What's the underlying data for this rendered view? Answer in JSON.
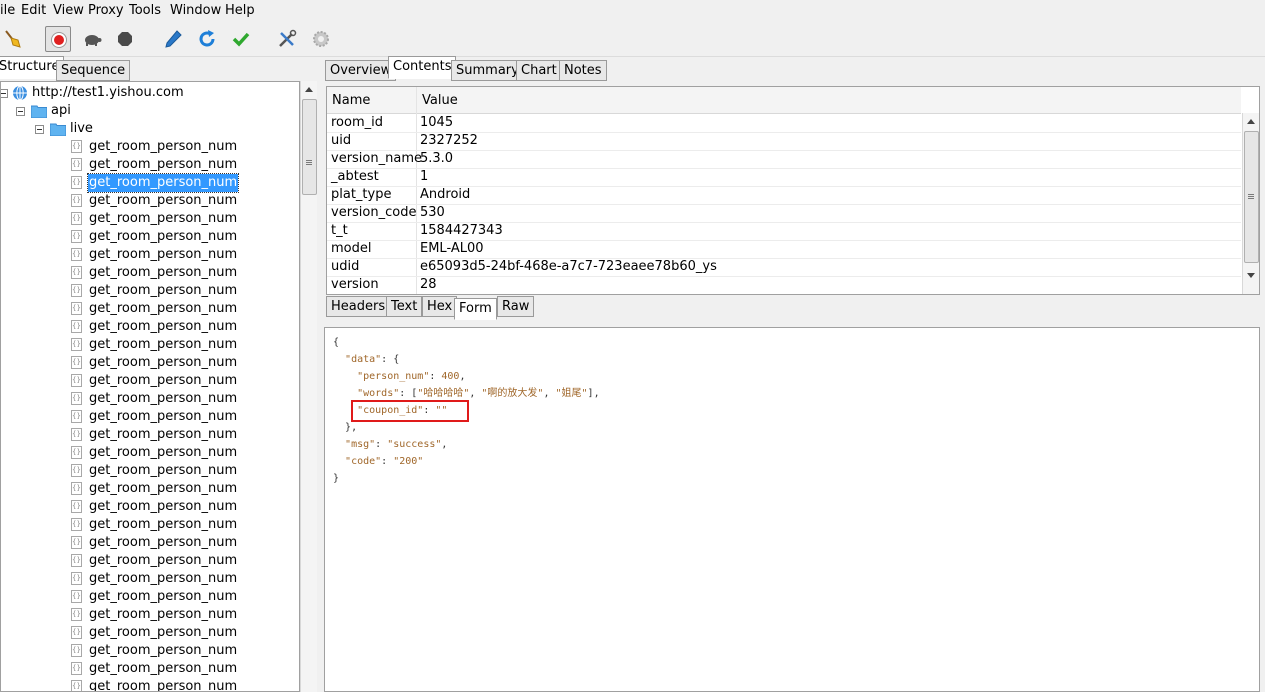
{
  "menubar": {
    "items": [
      "ile",
      "Edit",
      "View",
      "Proxy",
      "Tools",
      "Window",
      "Help"
    ]
  },
  "toolbar": {
    "buttons": [
      {
        "icon": "broom-icon"
      },
      {
        "icon": "record-icon",
        "pressed": true
      },
      {
        "icon": "turtle-icon"
      },
      {
        "icon": "stop-hexagon-icon"
      },
      {
        "icon": "pen-icon"
      },
      {
        "icon": "refresh-icon"
      },
      {
        "icon": "checkmark-icon"
      },
      {
        "icon": "tools-icon"
      },
      {
        "icon": "settings-gear-icon"
      }
    ],
    "colors": {
      "record": "#e02020",
      "refresh": "#1e7fd8",
      "check": "#2fa82f"
    }
  },
  "left_panel": {
    "tabs": [
      "Structure",
      "Sequence"
    ],
    "active_tab": "Structure",
    "tree": {
      "host": "http://test1.yishou.com",
      "folders": [
        "api",
        "live"
      ],
      "requests": [
        "get_room_person_num",
        "get_room_person_num",
        "get_room_person_num",
        "get_room_person_num",
        "get_room_person_num",
        "get_room_person_num",
        "get_room_person_num",
        "get_room_person_num",
        "get_room_person_num",
        "get_room_person_num",
        "get_room_person_num",
        "get_room_person_num",
        "get_room_person_num",
        "get_room_person_num",
        "get_room_person_num",
        "get_room_person_num",
        "get_room_person_num",
        "get_room_person_num",
        "get_room_person_num",
        "get_room_person_num",
        "get_room_person_num",
        "get_room_person_num",
        "get_room_person_num",
        "get_room_person_num",
        "get_room_person_num",
        "get_room_person_num",
        "get_room_person_num",
        "get_room_person_num",
        "get_room_person_num",
        "get_room_person_num",
        "get_room_person_num"
      ],
      "selected_index": 2,
      "selected_color": "#3399ff"
    }
  },
  "right_panel": {
    "tabs": [
      "Overview",
      "Contents",
      "Summary",
      "Chart",
      "Notes"
    ],
    "active_tab": "Contents",
    "grid": {
      "headers": [
        "Name",
        "Value"
      ],
      "rows": [
        {
          "name": "room_id",
          "value": "1045"
        },
        {
          "name": "uid",
          "value": "2327252"
        },
        {
          "name": "version_name",
          "value": "5.3.0"
        },
        {
          "name": "_abtest",
          "value": "1"
        },
        {
          "name": "plat_type",
          "value": "Android"
        },
        {
          "name": "version_code",
          "value": "530"
        },
        {
          "name": "t_t",
          "value": "1584427343"
        },
        {
          "name": "model",
          "value": "EML-AL00"
        },
        {
          "name": "udid",
          "value": "e65093d5-24bf-468e-a7c7-723eaee78b60_ys"
        },
        {
          "name": "version",
          "value": "28"
        }
      ]
    },
    "response_tabs": [
      "Headers",
      "Text",
      "Hex",
      "Form",
      "Raw"
    ],
    "active_response_tab": "Form",
    "response_body": {
      "l0": "{",
      "l1_key": "\"data\"",
      "l1_rest": ": {",
      "l2_key": "\"person_num\"",
      "l2_sep": ": ",
      "l2_val": "400",
      "l2_end": ",",
      "l3_key": "\"words\"",
      "l3_sep": ": [",
      "l3_v1": "\"哈哈哈哈\"",
      "l3_c1": ", ",
      "l3_v2": "\"啊的放大发\"",
      "l3_c2": ", ",
      "l3_v3": "\"姐尾\"",
      "l3_end": "],",
      "l4_key": "\"coupon_id\"",
      "l4_sep": ": ",
      "l4_val": "\"\"",
      "l5": "},",
      "l6_key": "\"msg\"",
      "l6_sep": ": ",
      "l6_val": "\"success\"",
      "l6_end": ",",
      "l7_key": "\"code\"",
      "l7_sep": ": ",
      "l7_val": "\"200\"",
      "l8": "}"
    },
    "annotation_color": "#e01a1a"
  }
}
